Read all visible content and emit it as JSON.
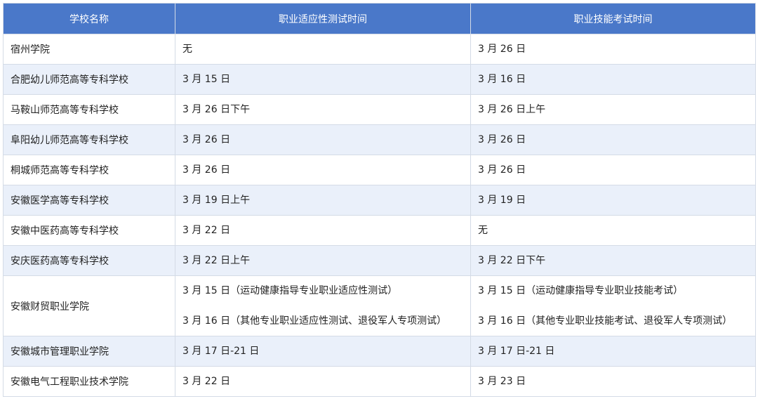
{
  "table": {
    "headers": [
      "学校名称",
      "职业适应性测试时间",
      "职业技能考试时间"
    ],
    "rows": [
      {
        "school": "宿州学院",
        "aptitude": [
          "无"
        ],
        "skill": [
          "3 月 26 日"
        ]
      },
      {
        "school": "合肥幼儿师范高等专科学校",
        "aptitude": [
          "3 月 15 日"
        ],
        "skill": [
          "3 月 16 日"
        ]
      },
      {
        "school": "马鞍山师范高等专科学校",
        "aptitude": [
          "3 月 26 日下午"
        ],
        "skill": [
          "3 月 26 日上午"
        ]
      },
      {
        "school": "阜阳幼儿师范高等专科学校",
        "aptitude": [
          "3 月 26 日"
        ],
        "skill": [
          "3 月 26 日"
        ]
      },
      {
        "school": "桐城师范高等专科学校",
        "aptitude": [
          "3 月 26 日"
        ],
        "skill": [
          "3 月 26 日"
        ]
      },
      {
        "school": "安徽医学高等专科学校",
        "aptitude": [
          "3 月 19 日上午"
        ],
        "skill": [
          "3 月 19 日"
        ]
      },
      {
        "school": "安徽中医药高等专科学校",
        "aptitude": [
          "3 月 22 日"
        ],
        "skill": [
          "无"
        ]
      },
      {
        "school": "安庆医药高等专科学校",
        "aptitude": [
          "3 月 22 日上午"
        ],
        "skill": [
          "3 月 22 日下午"
        ]
      },
      {
        "school": "安徽财贸职业学院",
        "aptitude": [
          "3 月 15 日（运动健康指导专业职业适应性测试）",
          "3 月 16 日（其他专业职业适应性测试、退役军人专项测试）"
        ],
        "skill": [
          "3 月 15 日（运动健康指导专业职业技能考试）",
          "3 月 16 日（其他专业职业技能考试、退役军人专项测试）"
        ]
      },
      {
        "school": "安徽城市管理职业学院",
        "aptitude": [
          "3 月 17 日-21 日"
        ],
        "skill": [
          "3 月 17 日-21 日"
        ]
      },
      {
        "school": "安徽电气工程职业技术学院",
        "aptitude": [
          "3 月 22 日"
        ],
        "skill": [
          "3 月 23 日"
        ]
      }
    ]
  }
}
